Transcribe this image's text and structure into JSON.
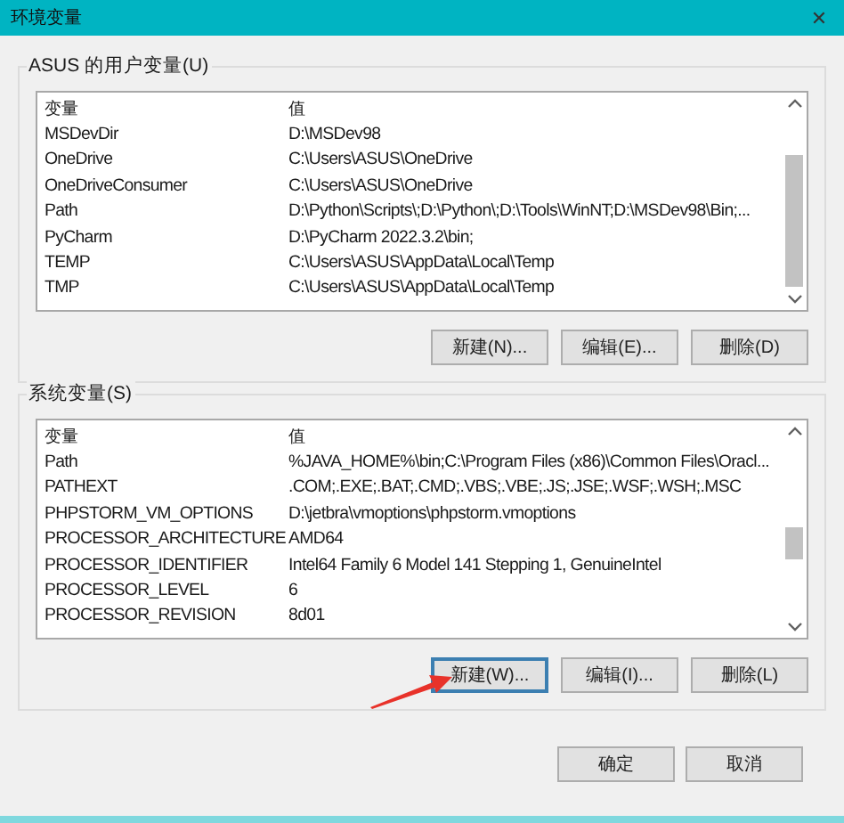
{
  "window": {
    "title": "环境变量",
    "close": "✕"
  },
  "groups": [
    {
      "label": "ASUS 的用户变量(U)",
      "columns": [
        "变量",
        "值"
      ],
      "rows": [
        {
          "name": "MSDevDir",
          "value": "D:\\MSDev98"
        },
        {
          "name": "OneDrive",
          "value": "C:\\Users\\ASUS\\OneDrive"
        },
        {
          "name": "OneDriveConsumer",
          "value": "C:\\Users\\ASUS\\OneDrive"
        },
        {
          "name": "Path",
          "value": "D:\\Python\\Scripts\\;D:\\Python\\;D:\\Tools\\WinNT;D:\\MSDev98\\Bin;..."
        },
        {
          "name": "PyCharm",
          "value": "D:\\PyCharm 2022.3.2\\bin;"
        },
        {
          "name": "TEMP",
          "value": "C:\\Users\\ASUS\\AppData\\Local\\Temp"
        },
        {
          "name": "TMP",
          "value": "C:\\Users\\ASUS\\AppData\\Local\\Temp"
        }
      ],
      "buttons": [
        {
          "label": "新建(N)...",
          "focused": false
        },
        {
          "label": "编辑(E)...",
          "focused": false
        },
        {
          "label": "删除(D)",
          "focused": false
        }
      ]
    },
    {
      "label": "系统变量(S)",
      "columns": [
        "变量",
        "值"
      ],
      "rows": [
        {
          "name": "Path",
          "value": "%JAVA_HOME%\\bin;C:\\Program Files (x86)\\Common Files\\Oracl..."
        },
        {
          "name": "PATHEXT",
          "value": ".COM;.EXE;.BAT;.CMD;.VBS;.VBE;.JS;.JSE;.WSF;.WSH;.MSC"
        },
        {
          "name": "PHPSTORM_VM_OPTIONS",
          "value": "D:\\jetbra\\vmoptions\\phpstorm.vmoptions"
        },
        {
          "name": "PROCESSOR_ARCHITECTURE",
          "value": "AMD64"
        },
        {
          "name": "PROCESSOR_IDENTIFIER",
          "value": "Intel64 Family 6 Model 141 Stepping 1, GenuineIntel"
        },
        {
          "name": "PROCESSOR_LEVEL",
          "value": "6"
        },
        {
          "name": "PROCESSOR_REVISION",
          "value": "8d01"
        }
      ],
      "buttons": [
        {
          "label": "新建(W)...",
          "focused": true
        },
        {
          "label": "编辑(I)...",
          "focused": false
        },
        {
          "label": "删除(L)",
          "focused": false
        }
      ]
    }
  ],
  "footer_buttons": [
    "确定",
    "取消"
  ]
}
